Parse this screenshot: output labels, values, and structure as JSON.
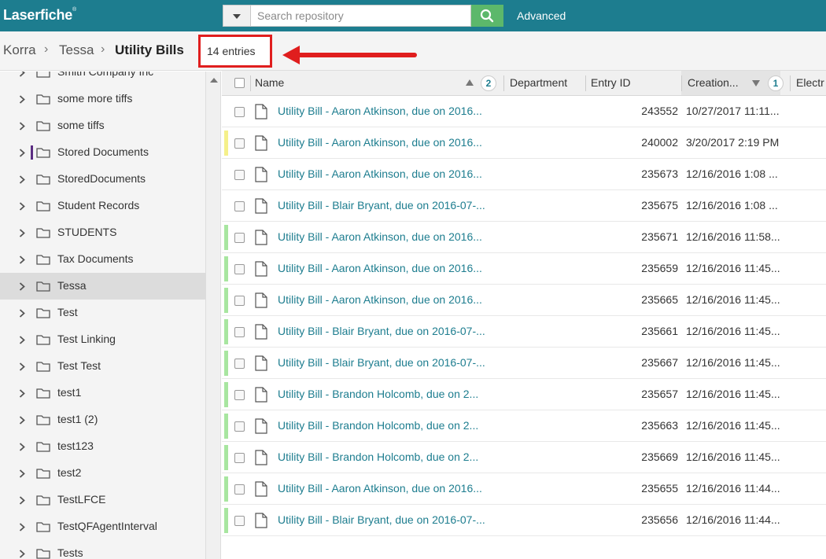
{
  "app": {
    "logo": "Laserfiche",
    "logo_mark": "®"
  },
  "search": {
    "placeholder": "Search repository",
    "advanced_label": "Advanced"
  },
  "breadcrumb": {
    "items": [
      "Korra",
      "Tessa",
      "Utility Bills"
    ],
    "separator": "›"
  },
  "entries_count": "14 entries",
  "sidebar": {
    "items": [
      {
        "label": "Smith Company Inc",
        "selected": false
      },
      {
        "label": "some more tiffs",
        "selected": false
      },
      {
        "label": "some tiffs",
        "selected": false
      },
      {
        "label": "Stored Documents",
        "selected": false,
        "marked": true
      },
      {
        "label": "StoredDocuments",
        "selected": false
      },
      {
        "label": "Student Records",
        "selected": false
      },
      {
        "label": "STUDENTS",
        "selected": false
      },
      {
        "label": "Tax Documents",
        "selected": false
      },
      {
        "label": "Tessa",
        "selected": true
      },
      {
        "label": "Test",
        "selected": false
      },
      {
        "label": "Test Linking",
        "selected": false
      },
      {
        "label": "Test Test",
        "selected": false
      },
      {
        "label": "test1",
        "selected": false
      },
      {
        "label": "test1 (2)",
        "selected": false
      },
      {
        "label": "test123",
        "selected": false
      },
      {
        "label": "test2",
        "selected": false
      },
      {
        "label": "TestLFCE",
        "selected": false
      },
      {
        "label": "TestQFAgentInterval",
        "selected": false
      },
      {
        "label": "Tests",
        "selected": false
      }
    ]
  },
  "table": {
    "columns": {
      "name": "Name",
      "name_sort": "2",
      "department": "Department",
      "entry_id": "Entry ID",
      "creation": "Creation...",
      "creation_sort": "1",
      "electronic": "Electr"
    },
    "rows": [
      {
        "name": "Utility Bill - Aaron Atkinson, due on 2016...",
        "entry_id": "243552",
        "created": "10/27/2017 11:11...",
        "flag": ""
      },
      {
        "name": "Utility Bill - Aaron Atkinson, due on 2016...",
        "entry_id": "240002",
        "created": "3/20/2017 2:19 PM",
        "flag": "#f5f08a"
      },
      {
        "name": "Utility Bill - Aaron Atkinson, due on 2016...",
        "entry_id": "235673",
        "created": "12/16/2016 1:08 ...",
        "flag": ""
      },
      {
        "name": "Utility Bill - Blair Bryant, due on 2016-07-...",
        "entry_id": "235675",
        "created": "12/16/2016 1:08 ...",
        "flag": ""
      },
      {
        "name": "Utility Bill - Aaron Atkinson, due on 2016...",
        "entry_id": "235671",
        "created": "12/16/2016 11:58...",
        "flag": "#a8e6a0"
      },
      {
        "name": "Utility Bill - Aaron Atkinson, due on 2016...",
        "entry_id": "235659",
        "created": "12/16/2016 11:45...",
        "flag": "#a8e6a0"
      },
      {
        "name": "Utility Bill - Aaron Atkinson, due on 2016...",
        "entry_id": "235665",
        "created": "12/16/2016 11:45...",
        "flag": "#a8e6a0"
      },
      {
        "name": "Utility Bill - Blair Bryant, due on 2016-07-...",
        "entry_id": "235661",
        "created": "12/16/2016 11:45...",
        "flag": "#a8e6a0"
      },
      {
        "name": "Utility Bill - Blair Bryant, due on 2016-07-...",
        "entry_id": "235667",
        "created": "12/16/2016 11:45...",
        "flag": "#a8e6a0"
      },
      {
        "name": "Utility Bill - Brandon Holcomb, due on 2...",
        "entry_id": "235657",
        "created": "12/16/2016 11:45...",
        "flag": "#a8e6a0"
      },
      {
        "name": "Utility Bill - Brandon Holcomb, due on 2...",
        "entry_id": "235663",
        "created": "12/16/2016 11:45...",
        "flag": "#a8e6a0"
      },
      {
        "name": "Utility Bill - Brandon Holcomb, due on 2...",
        "entry_id": "235669",
        "created": "12/16/2016 11:45...",
        "flag": "#a8e6a0"
      },
      {
        "name": "Utility Bill - Aaron Atkinson, due on 2016...",
        "entry_id": "235655",
        "created": "12/16/2016 11:44...",
        "flag": "#a8e6a0"
      },
      {
        "name": "Utility Bill - Blair Bryant, due on 2016-07-...",
        "entry_id": "235656",
        "created": "12/16/2016 11:44...",
        "flag": "#a8e6a0"
      }
    ]
  },
  "colors": {
    "header": "#1d7d8f",
    "search_button": "#5cb86b",
    "link": "#1d7d8f",
    "highlight": "#e01e1e"
  },
  "icons": {
    "search": "search-icon",
    "folder": "folder-icon",
    "document": "document-icon",
    "chevron": "chevron-right-icon",
    "arrow": "red-arrow-icon"
  }
}
